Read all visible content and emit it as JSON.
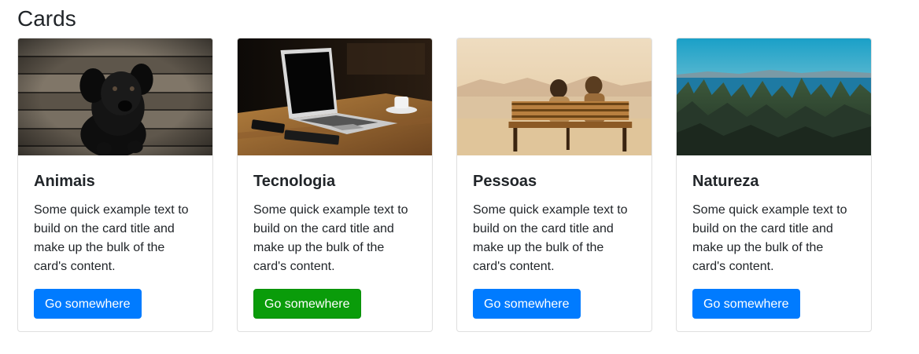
{
  "page": {
    "title": "Cards"
  },
  "cards": [
    {
      "title": "Animais",
      "text": "Some quick example text to build on the card title and make up the bulk of the card's content.",
      "button_label": "Go somewhere",
      "button_color": "#007bff",
      "image": "black puppy on wooden floor"
    },
    {
      "title": "Tecnologia",
      "text": "Some quick example text to build on the card title and make up the bulk of the card's content.",
      "button_label": "Go somewhere",
      "button_color": "#0a9c0a",
      "image": "laptop on wooden desk with coffee cup"
    },
    {
      "title": "Pessoas",
      "text": "Some quick example text to build on the card title and make up the bulk of the card's content.",
      "button_label": "Go somewhere",
      "button_color": "#007bff",
      "image": "couple on bench facing the sea"
    },
    {
      "title": "Natureza",
      "text": "Some quick example text to build on the card title and make up the bulk of the card's content.",
      "button_label": "Go somewhere",
      "button_color": "#007bff",
      "image": "pine forest with lake and mountains"
    }
  ]
}
